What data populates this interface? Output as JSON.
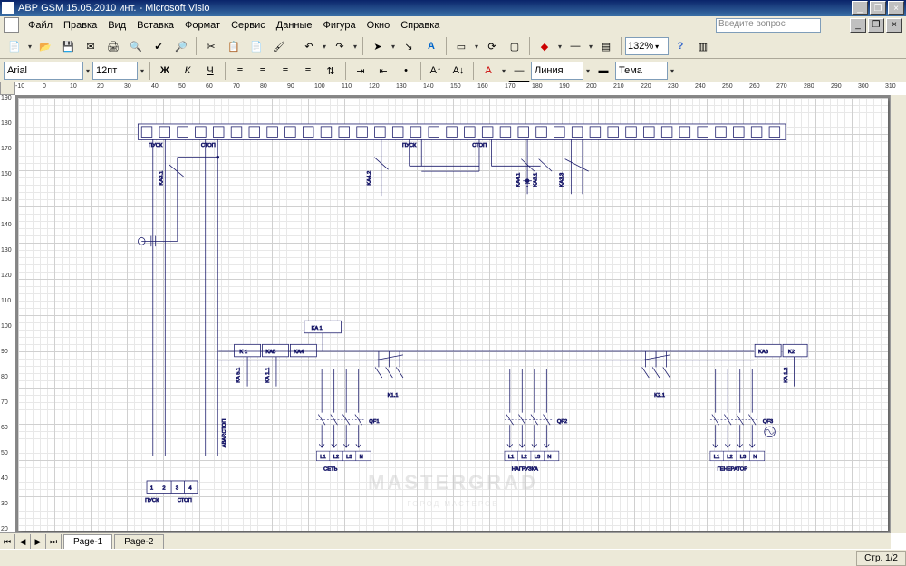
{
  "window": {
    "title": "АВР GSM 15.05.2010 инт. - Microsoft Visio"
  },
  "menu": {
    "file": "Файл",
    "edit": "Правка",
    "view": "Вид",
    "insert": "Вставка",
    "format": "Формат",
    "service": "Сервис",
    "data": "Данные",
    "shape": "Фигура",
    "window": "Окно",
    "help": "Справка",
    "search_placeholder": "Введите вопрос"
  },
  "toolbar": {
    "font": "Arial",
    "font_size": "12пт",
    "zoom": "132%",
    "line": "Линия",
    "fill": "Тема"
  },
  "ruler": {
    "h": [
      "-10",
      "0",
      "10",
      "20",
      "30",
      "40",
      "50",
      "60",
      "70",
      "80",
      "90",
      "100",
      "110",
      "120",
      "130",
      "140",
      "150",
      "160",
      "170",
      "180",
      "190",
      "200",
      "210",
      "220",
      "230",
      "240",
      "250",
      "260",
      "270",
      "280",
      "290",
      "300",
      "310"
    ],
    "v": [
      "190",
      "180",
      "170",
      "160",
      "150",
      "140",
      "130",
      "120",
      "110",
      "100",
      "90",
      "80",
      "70",
      "60",
      "50",
      "40",
      "30",
      "20"
    ]
  },
  "tabs": {
    "page1": "Page-1",
    "page2": "Page-2"
  },
  "status": {
    "page": "Стр. 1/2"
  },
  "diagram": {
    "top_labels": {
      "pusk": "ПУСК",
      "stop": "СТОП"
    },
    "mid_labels": {
      "pusk": "ПУСК",
      "stop": "СТОП"
    },
    "relay": {
      "ka31": "KA3.1",
      "ka42": "KA4.2",
      "ka41": "KA4.1",
      "ka31b": "KA3.1",
      "ka33": "KA3.3",
      "ka51": "KA 5.1",
      "ka11": "KA 1.1",
      "ka12": "KA 1.2"
    },
    "boxes": {
      "k1": "K 1",
      "ka5": "KA5",
      "ka4": "KA4",
      "ka1": "KA 1",
      "ka3": "KA3",
      "k2": "K2"
    },
    "contactors": {
      "k11": "K1.1",
      "k21": "K2.1"
    },
    "breakers": {
      "qf1": "QF1",
      "qf2": "QF2",
      "qf3": "QF3"
    },
    "phases": [
      "L1",
      "L2",
      "L3",
      "N"
    ],
    "bottom": {
      "set": "СЕТЬ",
      "nagruzka": "НАГРУЗКА",
      "generator": "ГЕНЕРАТОР"
    },
    "terms": [
      "1",
      "2",
      "3",
      "4"
    ],
    "term_labels": {
      "pusk": "ПУСК",
      "stop": "СТОП"
    },
    "avar": "АВАР.СТОП"
  },
  "watermark": "MASTERGRAD",
  "watermark2": "ГОРОД МАСТЕРОВ"
}
